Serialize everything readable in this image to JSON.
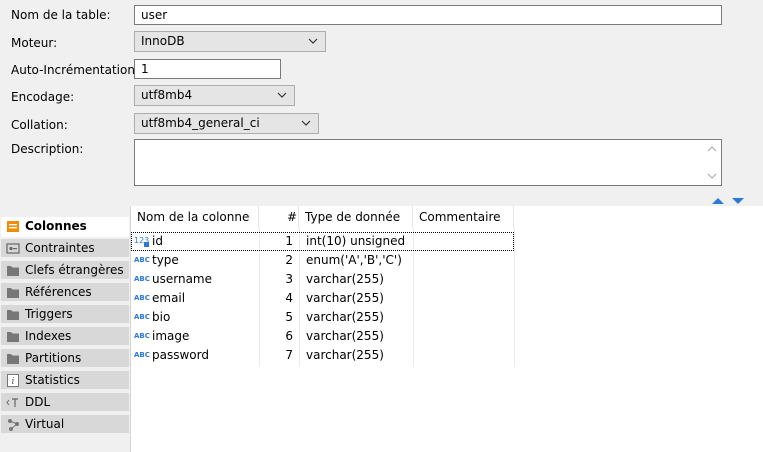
{
  "form": {
    "table_name_label": "Nom de la table:",
    "table_name_value": "user",
    "engine_label": "Moteur:",
    "engine_value": "InnoDB",
    "auto_increment_label": "Auto-Incrémentation:",
    "auto_increment_value": "1",
    "encoding_label": "Encodage:",
    "encoding_value": "utf8mb4",
    "collation_label": "Collation:",
    "collation_value": "utf8mb4_general_ci",
    "description_label": "Description:",
    "description_value": ""
  },
  "tabs": [
    {
      "label": "Colonnes",
      "icon": "columns-icon",
      "active": true
    },
    {
      "label": "Contraintes",
      "icon": "key-icon"
    },
    {
      "label": "Clefs étrangères",
      "icon": "folder-icon"
    },
    {
      "label": "Références",
      "icon": "folder-icon"
    },
    {
      "label": "Triggers",
      "icon": "folder-icon"
    },
    {
      "label": "Indexes",
      "icon": "folder-icon"
    },
    {
      "label": "Partitions",
      "icon": "folder-icon"
    },
    {
      "label": "Statistics",
      "icon": "info-icon"
    },
    {
      "label": "DDL",
      "icon": "ddl-icon"
    },
    {
      "label": "Virtual",
      "icon": "virtual-icon"
    }
  ],
  "grid": {
    "headers": [
      "Nom de la colonne",
      "#",
      "Type de donnée",
      "Commentaire"
    ],
    "rows": [
      {
        "name": "id",
        "num": "1",
        "type": "int(10) unsigned",
        "icon": "numeric-key-icon"
      },
      {
        "name": "type",
        "num": "2",
        "type": "enum('A','B','C')",
        "icon": "text-type-icon"
      },
      {
        "name": "username",
        "num": "3",
        "type": "varchar(255)",
        "icon": "text-type-icon"
      },
      {
        "name": "email",
        "num": "4",
        "type": "varchar(255)",
        "icon": "text-type-icon"
      },
      {
        "name": "bio",
        "num": "5",
        "type": "varchar(255)",
        "icon": "text-type-icon"
      },
      {
        "name": "image",
        "num": "6",
        "type": "varchar(255)",
        "icon": "text-type-icon"
      },
      {
        "name": "password",
        "num": "7",
        "type": "varchar(255)",
        "icon": "text-type-icon"
      }
    ],
    "selected_row": 0
  },
  "colors": {
    "accent": "#2b79d8",
    "tab_active_icon": "#f28c00"
  }
}
